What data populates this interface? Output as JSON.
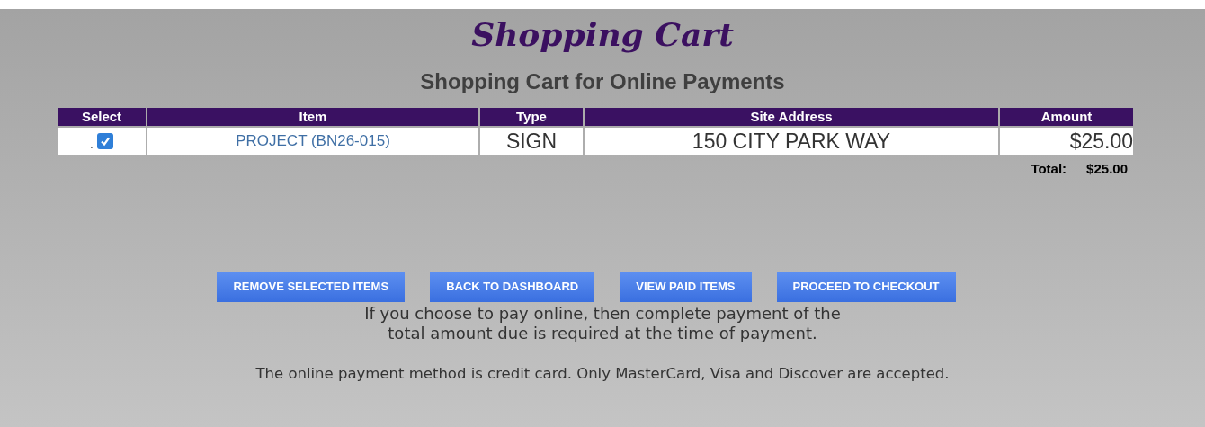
{
  "title": "Shopping Cart",
  "subtitle": "Shopping Cart for Online Payments",
  "table": {
    "columns": [
      "Select",
      "Item",
      "Type",
      "Site Address",
      "Amount"
    ],
    "rows": [
      {
        "marker": ".",
        "checked": true,
        "item": "PROJECT (BN26-015)",
        "type": "SIGN",
        "site_address": "150 CITY PARK WAY",
        "amount": "$25.00"
      }
    ]
  },
  "total": {
    "label": "Total:",
    "value": "$25.00"
  },
  "buttons": [
    "REMOVE SELECTED ITEMS",
    "BACK TO DASHBOARD",
    "VIEW PAID ITEMS",
    "PROCEED TO CHECKOUT"
  ],
  "notice_lines": [
    "If you choose to pay online, then complete payment of the",
    "total amount due is required at the time of payment."
  ],
  "payment_note": "The online payment method is credit card. Only MasterCard, Visa and Discover are accepted."
}
